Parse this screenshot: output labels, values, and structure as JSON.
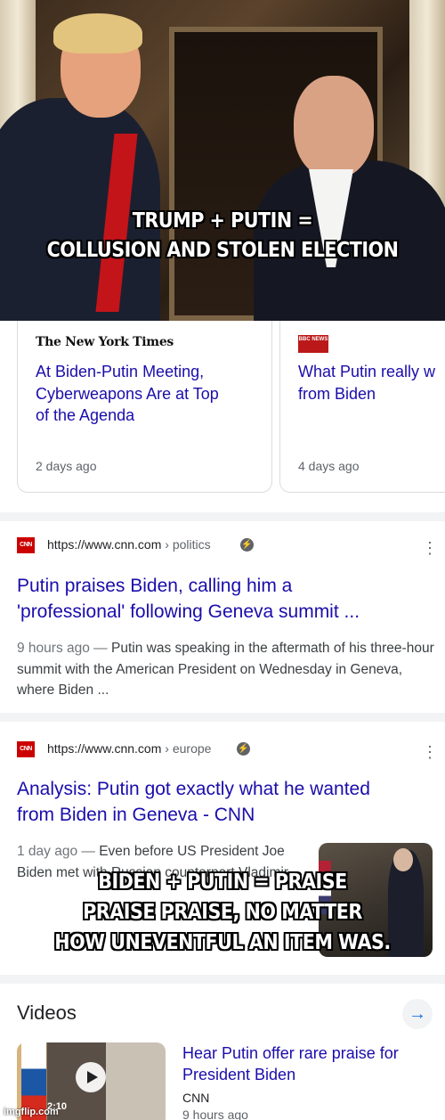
{
  "meme": {
    "top_text": "TRUMP + PUTIN =\nCOLLUSION AND STOLEN ELECTION",
    "bottom_text": "BIDEN + PUTIN = PRAISE\nPRAISE PRAISE, NO MATTER\nHOW UNEVENTFUL AN ITEM WAS.",
    "watermark": "imgflip.com"
  },
  "top_stories": [
    {
      "source": "The New York Times",
      "title": "At Biden-Putin Meeting,\nCyberweapons Are at Top\nof the Agenda",
      "time": "2 days ago"
    },
    {
      "source": "BBC NEWS",
      "title": "What Putin really w\nfrom Biden",
      "time": "4 days ago"
    }
  ],
  "results": [
    {
      "favicon": "CNN",
      "url": "https://www.cnn.com",
      "crumb": "› politics",
      "title": "Putin praises Biden, calling him a\n'professional' following Geneva summit ...",
      "date": "9 hours ago",
      "dash": " — ",
      "snippet": "Putin was speaking in the aftermath of his three-hour summit with the American President on Wednesday in Geneva, where Biden ..."
    },
    {
      "favicon": "CNN",
      "url": "https://www.cnn.com",
      "crumb": "› europe",
      "title": "Analysis: Putin got exactly what he wanted\nfrom Biden in Geneva - CNN",
      "date": "1 day ago",
      "dash": " — ",
      "snippet": "Even before US President Joe Biden met with Russian counterpart Vladimir"
    }
  ],
  "videos": {
    "heading": "Videos",
    "item": {
      "title": "Hear Putin offer rare praise for\nPresident Biden",
      "source": "CNN",
      "time": "9 hours ago",
      "duration": "2:10"
    }
  },
  "icons": {
    "amp": "lightning-bolt-icon",
    "more": "more-vert-icon",
    "arrow": "arrow-right-icon",
    "play": "play-icon"
  },
  "colors": {
    "link": "#1a0dab",
    "cnn_red": "#cc0000",
    "bbc_red": "#bb1919"
  }
}
